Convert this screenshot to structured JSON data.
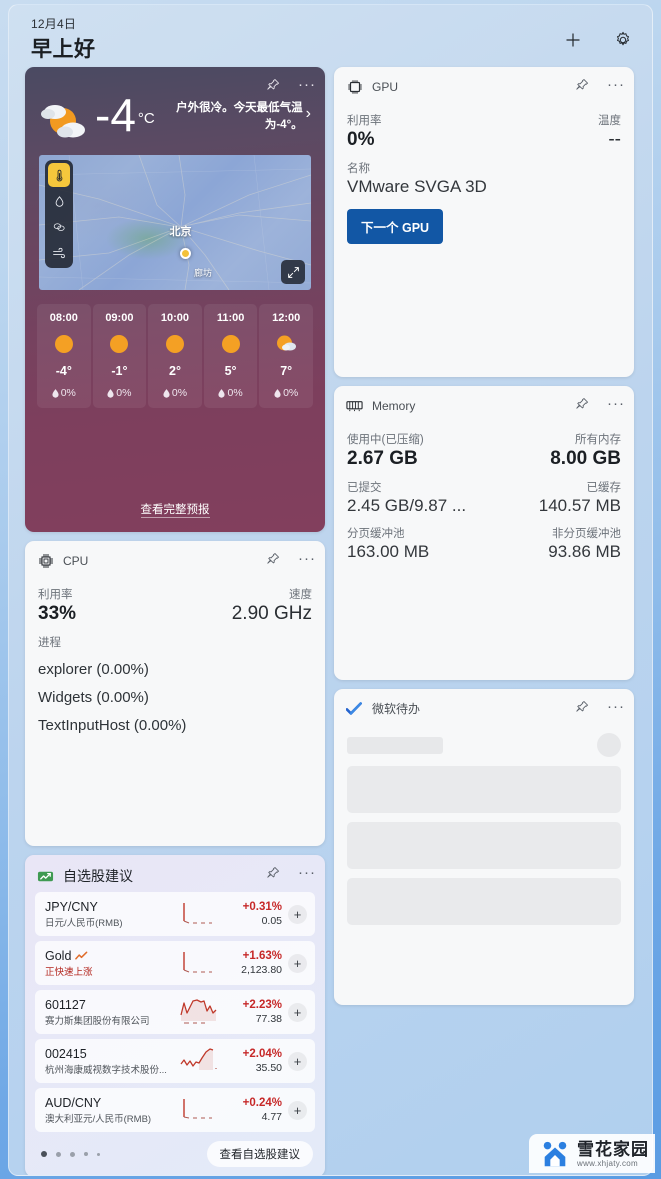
{
  "header": {
    "date": "12月4日",
    "greeting": "早上好",
    "add_label": "+",
    "settings_label": "设置"
  },
  "weather": {
    "temp": "-4",
    "unit": "°C",
    "description": "户外很冷。今天最低气温为-4°。",
    "chevron": "›",
    "map": {
      "city": "北京",
      "city2": "廊坊"
    },
    "layers": [
      {
        "name": "temperature",
        "glyph": "🌡",
        "active": true
      },
      {
        "name": "precipitation",
        "glyph": "💧",
        "active": false
      },
      {
        "name": "clouds",
        "glyph": "☁",
        "active": false
      },
      {
        "name": "wind",
        "glyph": "💨",
        "active": false
      }
    ],
    "hours": [
      {
        "time": "08:00",
        "icon": "sunny",
        "temp": "-4°",
        "precip": "0%"
      },
      {
        "time": "09:00",
        "icon": "sunny",
        "temp": "-1°",
        "precip": "0%"
      },
      {
        "time": "10:00",
        "icon": "sunny",
        "temp": "2°",
        "precip": "0%"
      },
      {
        "time": "11:00",
        "icon": "sunny",
        "temp": "5°",
        "precip": "0%"
      },
      {
        "time": "12:00",
        "icon": "partly-cloudy",
        "temp": "7°",
        "precip": "0%"
      }
    ],
    "forecast_link": "查看完整预报"
  },
  "cpu": {
    "title": "CPU",
    "usage_label": "利用率",
    "usage_value": "33%",
    "speed_label": "速度",
    "speed_value": "2.90 GHz",
    "processes_label": "进程",
    "processes": [
      "explorer (0.00%)",
      "Widgets (0.00%)",
      "TextInputHost (0.00%)"
    ]
  },
  "gpu": {
    "title": "GPU",
    "usage_label": "利用率",
    "usage_value": "0%",
    "temp_label": "温度",
    "temp_value": "--",
    "name_label": "名称",
    "name_value": "VMware SVGA 3D",
    "next_button": "下一个 GPU"
  },
  "memory": {
    "title": "Memory",
    "inuse_label": "使用中(已压缩)",
    "inuse_value": "2.67 GB",
    "total_label": "所有内存",
    "total_value": "8.00 GB",
    "committed_label": "已提交",
    "committed_value": "2.45 GB/9.87 ...",
    "cached_label": "已缓存",
    "cached_value": "140.57 MB",
    "paged_label": "分页缓冲池",
    "paged_value": "163.00 MB",
    "nonpaged_label": "非分页缓冲池",
    "nonpaged_value": "93.86 MB"
  },
  "stocks": {
    "title": "自选股建议",
    "rows": [
      {
        "symbol": "JPY/CNY",
        "sub": "日元/人民币(RMB)",
        "sub_up": false,
        "badge": "",
        "pct": "+0.31%",
        "price": "0.05",
        "trend": "flat"
      },
      {
        "symbol": "Gold",
        "sub": "正快速上涨",
        "sub_up": true,
        "badge": "📈",
        "pct": "+1.63%",
        "price": "2,123.80",
        "trend": "flat"
      },
      {
        "symbol": "601127",
        "sub": "赛力斯集团股份有限公司",
        "sub_up": false,
        "badge": "",
        "pct": "+2.23%",
        "price": "77.38",
        "trend": "volatile"
      },
      {
        "symbol": "002415",
        "sub": "杭州海康威视数字技术股份...",
        "sub_up": false,
        "badge": "",
        "pct": "+2.04%",
        "price": "35.50",
        "trend": "rising"
      },
      {
        "symbol": "AUD/CNY",
        "sub": "澳大利亚元/人民币(RMB)",
        "sub_up": false,
        "badge": "",
        "pct": "+0.24%",
        "price": "4.77",
        "trend": "flat"
      }
    ],
    "page_dots": 5,
    "active_dot": 0,
    "link": "查看自选股建议"
  },
  "todo": {
    "title": "微软待办"
  },
  "widget_actions": {
    "pin": "固定",
    "more": "更多选项"
  },
  "watermark": {
    "title": "雪花家园",
    "url": "www.xhjaty.com"
  },
  "colors": {
    "accent_blue": "#1257a5",
    "stock_up_red": "#c62828",
    "layer_active": "#f5c73c"
  }
}
